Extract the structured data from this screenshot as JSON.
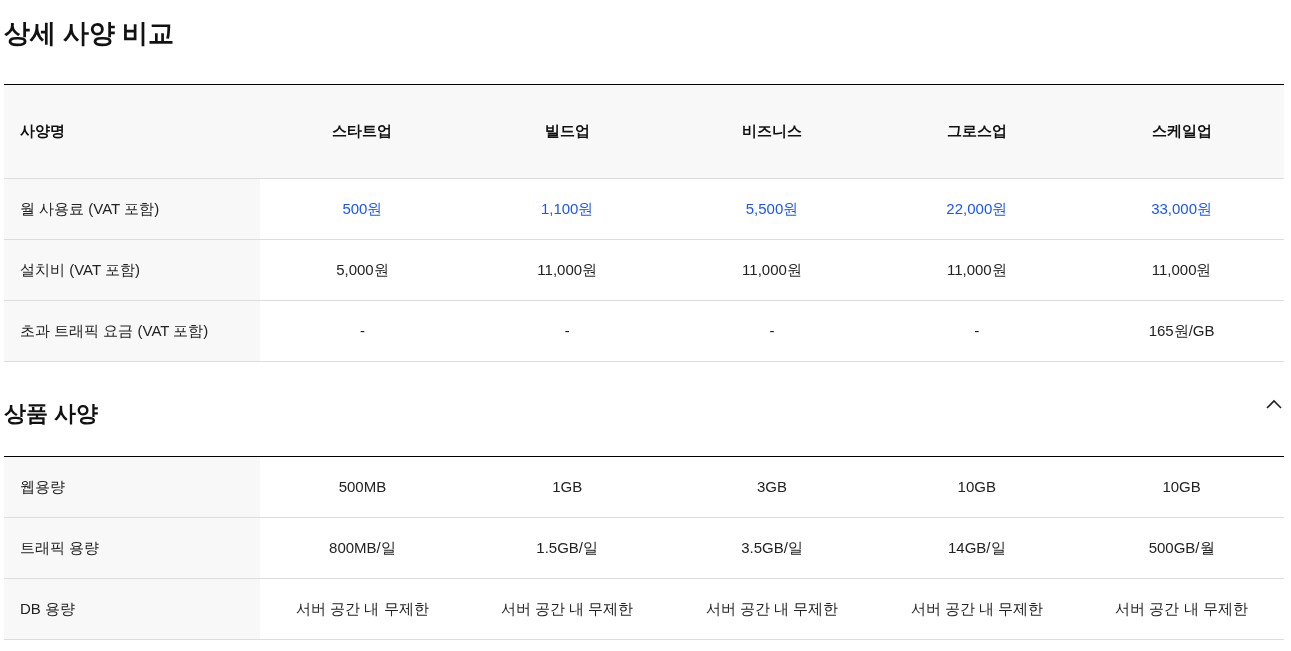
{
  "title": "상세 사양 비교",
  "table": {
    "columns": [
      "사양명",
      "스타트업",
      "빌드업",
      "비즈니스",
      "그로스업",
      "스케일업"
    ],
    "rows": [
      {
        "highlight": true,
        "cells": [
          "월 사용료 (VAT 포함)",
          "500원",
          "1,100원",
          "5,500원",
          "22,000원",
          "33,000원"
        ]
      },
      {
        "highlight": false,
        "cells": [
          "설치비 (VAT 포함)",
          "5,000원",
          "11,000원",
          "11,000원",
          "11,000원",
          "11,000원"
        ]
      },
      {
        "highlight": false,
        "cells": [
          "초과 트래픽 요금 (VAT 포함)",
          "-",
          "-",
          "-",
          "-",
          "165원/GB"
        ]
      }
    ]
  },
  "sections": [
    {
      "title": "상품 사양",
      "expanded": true,
      "rows": [
        {
          "highlight": false,
          "cells": [
            "웹용량",
            "500MB",
            "1GB",
            "3GB",
            "10GB",
            "10GB"
          ]
        },
        {
          "highlight": false,
          "cells": [
            "트래픽 용량",
            "800MB/일",
            "1.5GB/일",
            "3.5GB/일",
            "14GB/일",
            "500GB/월"
          ]
        },
        {
          "highlight": false,
          "cells": [
            "DB 용량",
            "서버 공간 내 무제한",
            "서버 공간 내 무제한",
            "서버 공간 내 무제한",
            "서버 공간 내 무제한",
            "서버 공간 내 무제한"
          ]
        }
      ]
    }
  ]
}
